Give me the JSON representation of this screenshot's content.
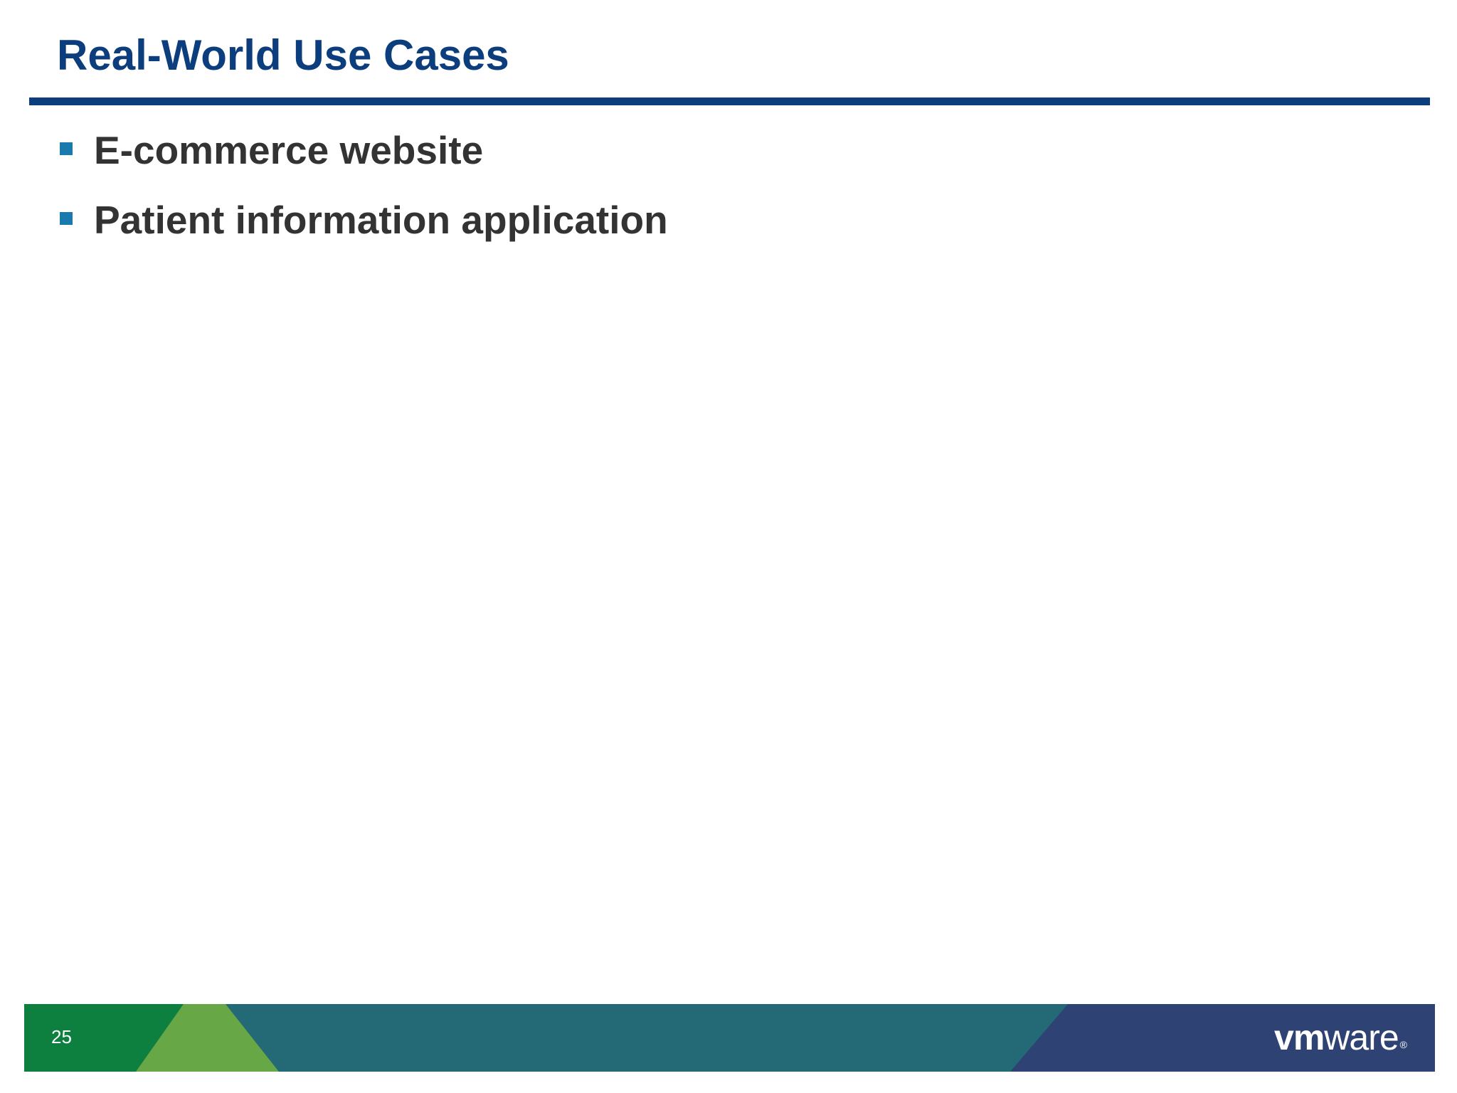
{
  "slide": {
    "title": "Real-World Use Cases",
    "bullets": [
      "E-commerce website",
      "Patient information application"
    ]
  },
  "footer": {
    "page_number": "25",
    "logo": {
      "part1": "vm",
      "part2": "ware",
      "mark": "®"
    }
  },
  "colors": {
    "title": "#0c3d7c",
    "rule": "#0c3d7c",
    "bullet_marker": "#1a7aae",
    "body_text": "#333333",
    "footer_dark_green": "#0d7f3f",
    "footer_light_green": "#68a745",
    "footer_teal": "#246a76",
    "footer_navy": "#2e4373"
  }
}
